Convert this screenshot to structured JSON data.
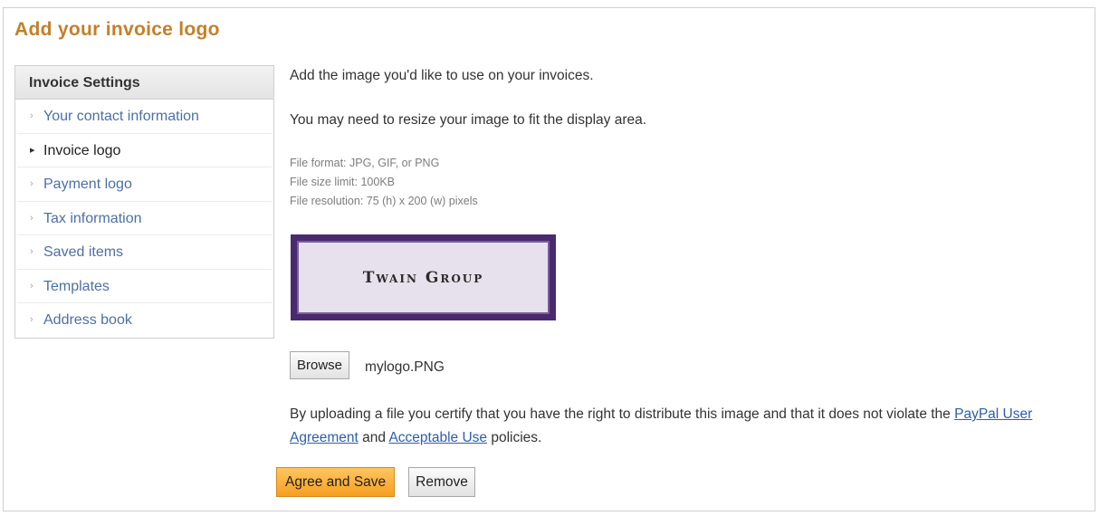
{
  "page": {
    "title": "Add your invoice logo"
  },
  "sidebar": {
    "header": "Invoice Settings",
    "items": [
      {
        "label": "Your contact information",
        "active": false
      },
      {
        "label": "Invoice logo",
        "active": true
      },
      {
        "label": "Payment logo",
        "active": false
      },
      {
        "label": "Tax information",
        "active": false
      },
      {
        "label": "Saved items",
        "active": false
      },
      {
        "label": "Templates",
        "active": false
      },
      {
        "label": "Address book",
        "active": false
      }
    ]
  },
  "main": {
    "intro": "Add the image you'd like to use on your invoices.",
    "resize_note": "You may need to resize your image to fit the display area.",
    "specs": {
      "format": "File format: JPG, GIF, or PNG",
      "size_limit": "File size limit: 100KB",
      "resolution": "File resolution: 75 (h) x 200 (w) pixels"
    },
    "logo_preview_text": "Twain Group",
    "browse_label": "Browse",
    "file_name": "mylogo.PNG",
    "terms": {
      "before": "By uploading a file you certify that you have the right to distribute this image and that it does not violate the ",
      "link1": "PayPal User Agreement",
      "middle": " and ",
      "link2": "Acceptable Use",
      "after": " policies."
    },
    "agree_save_label": "Agree and Save",
    "remove_label": "Remove"
  },
  "colors": {
    "title": "#c47f2a",
    "link": "#4d6fa6",
    "primary_button": "#f5a01f",
    "logo_border": "#4a2a6e"
  }
}
